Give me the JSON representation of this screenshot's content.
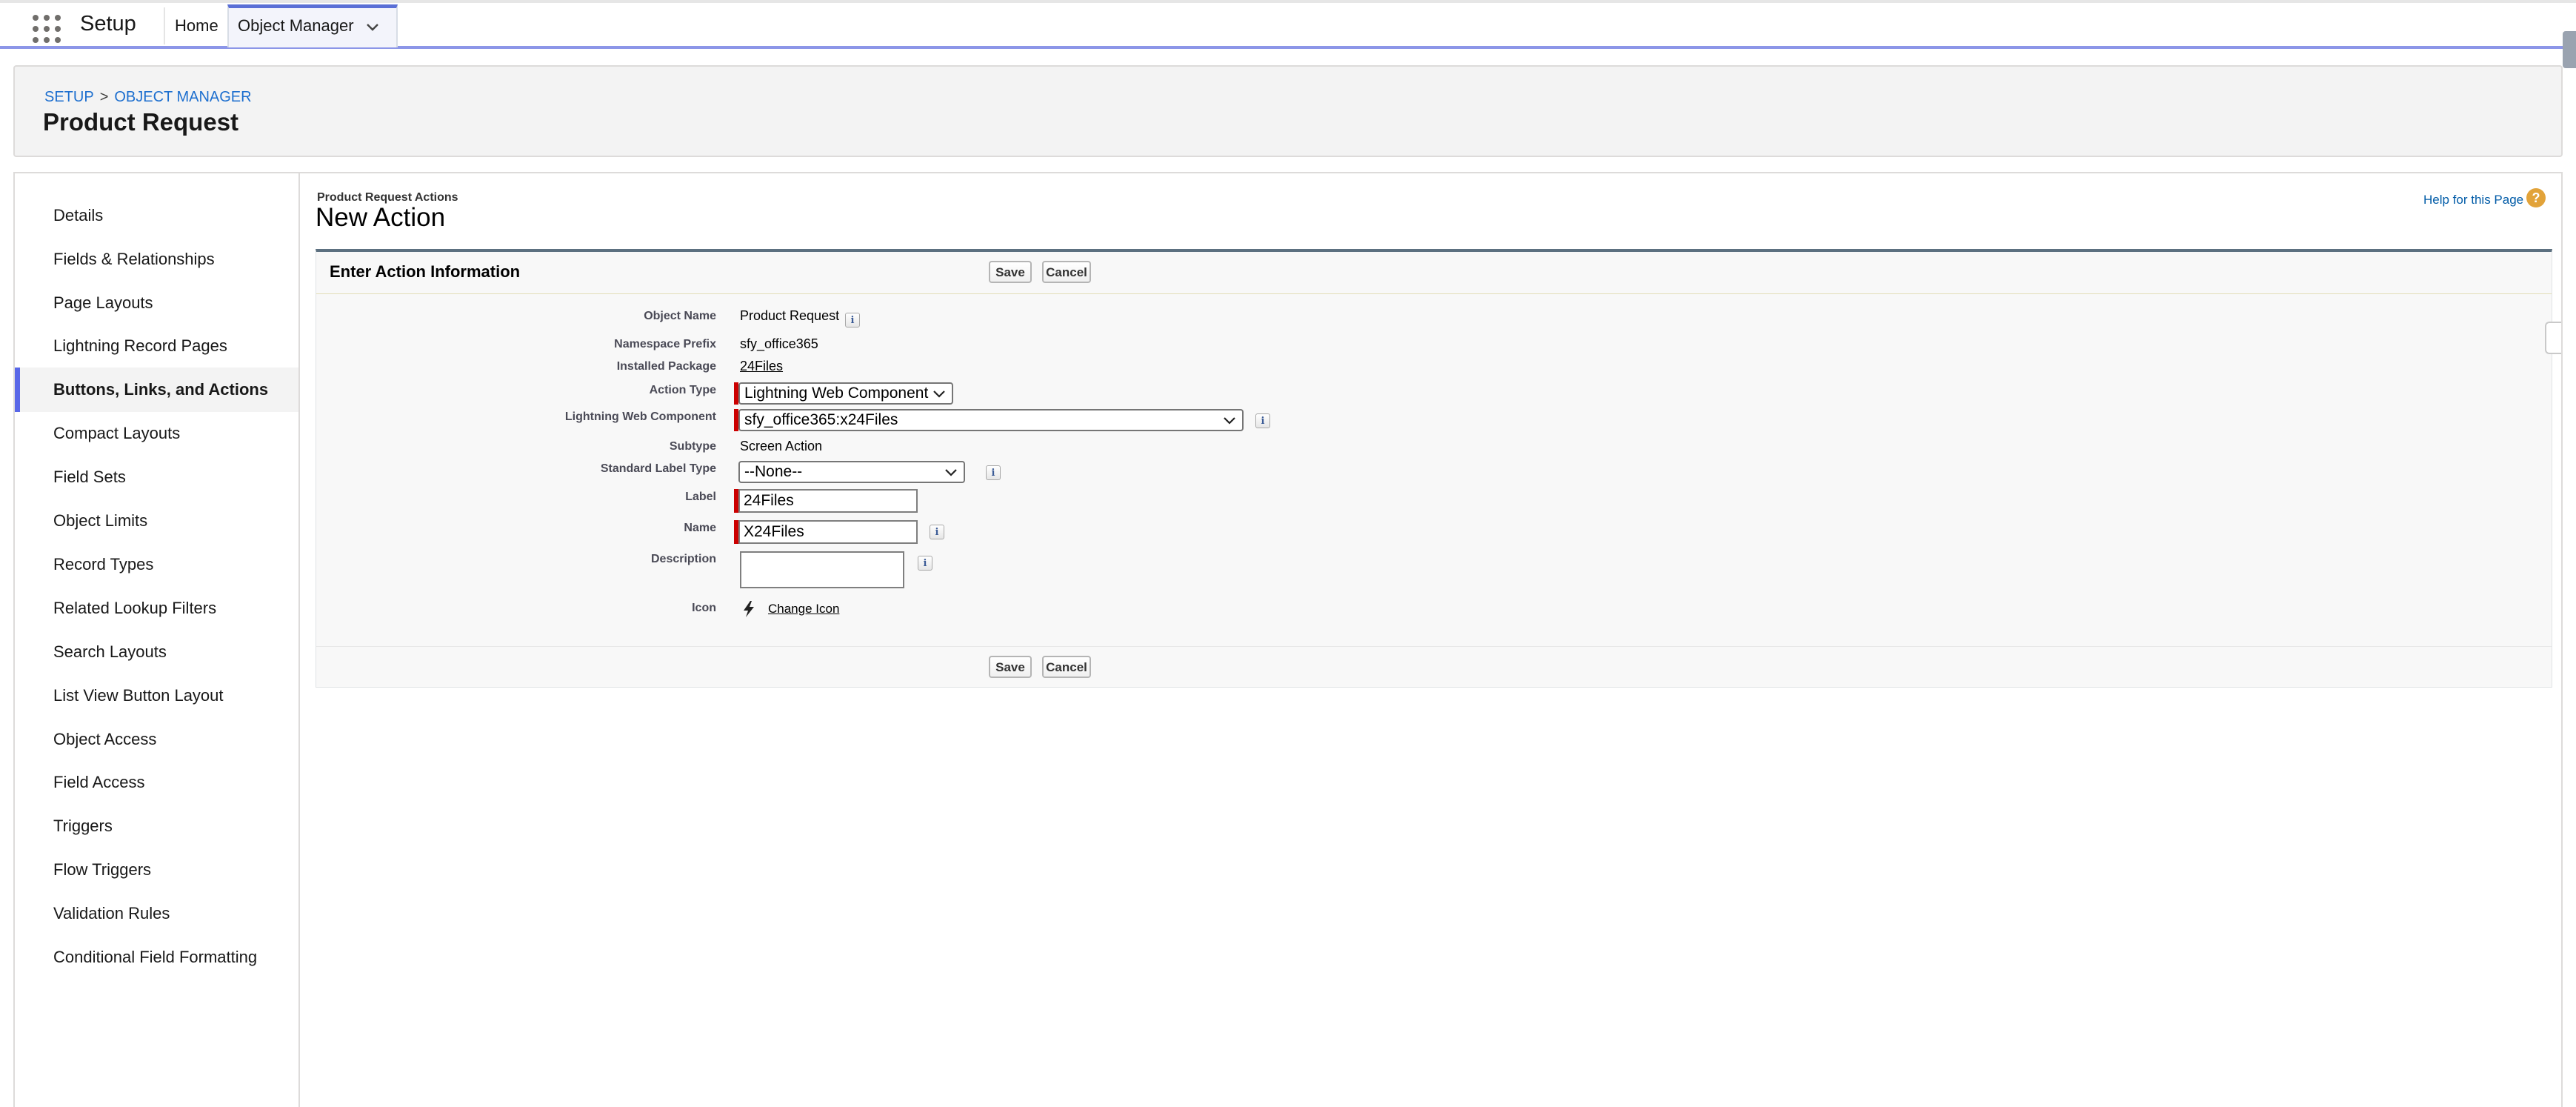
{
  "header": {
    "app_name": "Setup",
    "nav": {
      "home": "Home",
      "object_manager": "Object Manager"
    }
  },
  "page_header": {
    "breadcrumb": {
      "setup": "SETUP",
      "separator": ">",
      "object_manager": "OBJECT MANAGER"
    },
    "title": "Product Request"
  },
  "sidebar": {
    "items": [
      {
        "label": "Details"
      },
      {
        "label": "Fields & Relationships"
      },
      {
        "label": "Page Layouts"
      },
      {
        "label": "Lightning Record Pages"
      },
      {
        "label": "Buttons, Links, and Actions",
        "active": true
      },
      {
        "label": "Compact Layouts"
      },
      {
        "label": "Field Sets"
      },
      {
        "label": "Object Limits"
      },
      {
        "label": "Record Types"
      },
      {
        "label": "Related Lookup Filters"
      },
      {
        "label": "Search Layouts"
      },
      {
        "label": "List View Button Layout"
      },
      {
        "label": "Object Access"
      },
      {
        "label": "Field Access"
      },
      {
        "label": "Triggers"
      },
      {
        "label": "Flow Triggers"
      },
      {
        "label": "Validation Rules"
      },
      {
        "label": "Conditional Field Formatting"
      }
    ]
  },
  "content": {
    "subtitle": "Product Request Actions",
    "title": "New Action",
    "help_link": "Help for this Page",
    "help_icon": "?",
    "section": {
      "title": "Enter Action Information",
      "save_label": "Save",
      "cancel_label": "Cancel",
      "info_glyph": "i",
      "fields": {
        "object_name": {
          "label": "Object Name",
          "value": "Product Request"
        },
        "namespace_prefix": {
          "label": "Namespace Prefix",
          "value": "sfy_office365"
        },
        "installed_package": {
          "label": "Installed Package",
          "value": "24Files"
        },
        "action_type": {
          "label": "Action Type",
          "value": "Lightning Web Component"
        },
        "lwc": {
          "label": "Lightning Web Component",
          "value": "sfy_office365:x24Files"
        },
        "subtype": {
          "label": "Subtype",
          "value": "Screen Action"
        },
        "standard_label_type": {
          "label": "Standard Label Type",
          "value": "--None--"
        },
        "label": {
          "label": "Label",
          "value": "24Files"
        },
        "name": {
          "label": "Name",
          "value": "X24Files"
        },
        "description": {
          "label": "Description",
          "value": ""
        },
        "icon": {
          "label": "Icon",
          "change_link": "Change Icon",
          "icon_name": "lightning-bolt-icon"
        }
      }
    }
  },
  "colors": {
    "active_accent": "#5867e8",
    "link": "#015ba7",
    "required": "#cc0000",
    "section_border": "#5c7080"
  }
}
